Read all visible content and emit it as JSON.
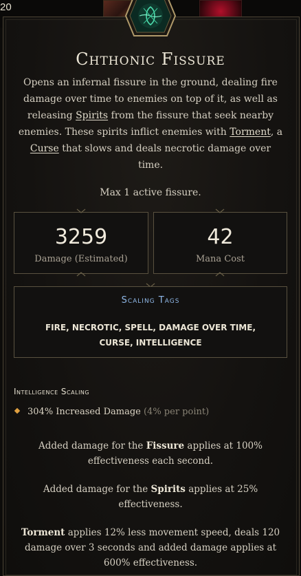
{
  "header": {
    "level": "20"
  },
  "skill": {
    "name": "Chthonic Fissure",
    "description": {
      "p1": "Opens an infernal fissure in the ground, dealing fire damage over time to enemies on top of it, as well as releasing ",
      "k_spirits": "Spirits",
      "p2": " from the fissure that seek nearby enemies. These spirits inflict enemies with ",
      "k_torment": "Torment",
      "p3": ", a ",
      "k_curse": "Curse",
      "p4": " that slows and deals necrotic damage over time."
    },
    "max_line": "Max 1 active fissure."
  },
  "stats": {
    "damage": {
      "value": "3259",
      "label": "Damage (Estimated)"
    },
    "mana": {
      "value": "42",
      "label": "Mana Cost"
    }
  },
  "tags": {
    "title": "Scaling Tags",
    "list": "FIRE, NECROTIC, SPELL, DAMAGE OVER TIME, CURSE, INTELLIGENCE"
  },
  "scaling": {
    "heading": "Intelligence Scaling",
    "bonus": "304% Increased Damage",
    "per_point": "(4% per point)"
  },
  "notes": {
    "fissure": {
      "a": "Added damage for the ",
      "k": "Fissure",
      "b": " applies at 100% effectiveness each second."
    },
    "spirits": {
      "a": "Added damage for the ",
      "k": "Spirits",
      "b": " applies at 25% effectiveness."
    },
    "torment": {
      "k": "Torment",
      "b": " applies 12% less movement speed, deals 120 damage over 3 seconds and added damage applies at 600% effectiveness."
    }
  },
  "colors": {
    "tag_title": "#8fb8e8",
    "bullet": "#e0a040",
    "border": "#5a5240"
  }
}
